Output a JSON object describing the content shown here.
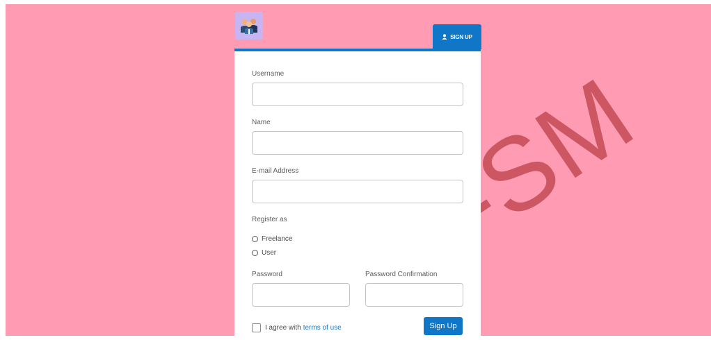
{
  "header": {
    "signup_tab_label": "SIGN UP"
  },
  "form": {
    "username_label": "Username",
    "username_value": "",
    "name_label": "Name",
    "name_value": "",
    "email_label": "E-mail Address",
    "email_value": "",
    "register_as_label": "Register as",
    "register_options": [
      "Freelance",
      "User"
    ],
    "password_label": "Password",
    "password_value": "",
    "password_confirmation_label": "Password Confirmation",
    "password_confirmation_value": "",
    "agree_text": "I agree with",
    "terms_link_text": "terms of use",
    "submit_label": "Sign Up"
  },
  "watermark_text": "-SM",
  "colors": {
    "background": "#ff9cb3",
    "accent": "#0f76c8",
    "logo_background": "#c8b4f0",
    "watermark": "#c0464f"
  },
  "icons": {
    "logo": "team-users-icon",
    "signup_tab": "user-icon"
  }
}
